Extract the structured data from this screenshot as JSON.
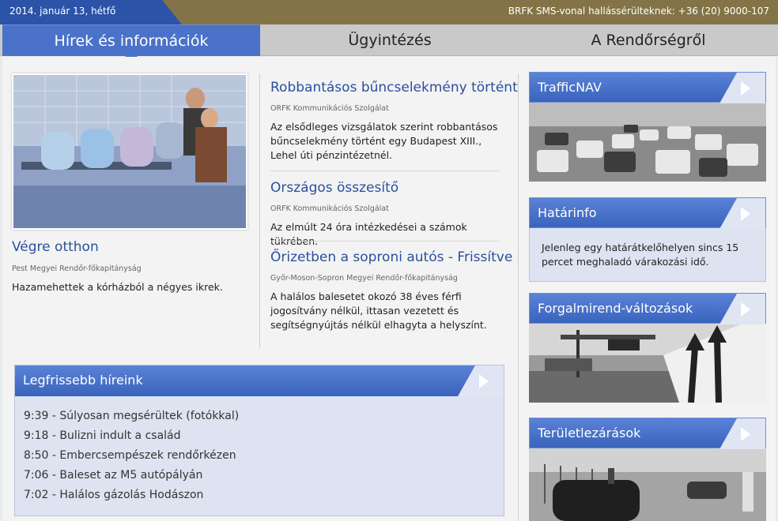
{
  "topbar": {
    "date": "2014. január 13, hétfő",
    "sms_notice": "BRFK SMS-vonal hallássérülteknek: +36 (20) 9000-107"
  },
  "nav": {
    "tabs": [
      {
        "label": "Hírek és információk",
        "active": true
      },
      {
        "label": "Ügyintézés",
        "active": false
      },
      {
        "label": "A Rendőrségről",
        "active": false
      }
    ]
  },
  "lead": {
    "title": "Végre otthon",
    "source": "Pest Megyei Rendőr-főkapitányság",
    "text": "Hazamehettek a kórházból a négyes ikrek."
  },
  "articles": [
    {
      "title": "Robbantásos bűncselekmény történt",
      "source": "ORFK Kommunikációs Szolgálat",
      "text": "Az elsődleges vizsgálatok szerint robbantásos bűncselekmény történt egy Budapest XIII., Lehel úti pénzintézetnél."
    },
    {
      "title": "Országos összesítő",
      "source": "ORFK Kommunikációs Szolgálat",
      "text": "Az elmúlt 24 óra intézkedései a számok tükrében."
    },
    {
      "title": "Őrizetben a soproni autós - Frissítve",
      "source": "Győr-Moson-Sopron Megyei Rendőr-főkapitányság",
      "text": "A halálos balesetet okozó 38 éves férfi jogosítvány nélkül, ittasan vezetett és segítségnyújtás nélkül elhagyta a helyszínt."
    }
  ],
  "latest": {
    "title": "Legfrissebb híreink",
    "items": [
      "9:39 - Súlyosan megsérültek (fotókkal)",
      "9:18 - Bulizni indult a család",
      "8:50 - Embercsempészek rendőrkézen",
      "7:06 - Baleset az M5 autópályán",
      "7:02 - Halálos gázolás Hodászon"
    ]
  },
  "widgets": {
    "trafficnav": {
      "title": "TrafficNAV"
    },
    "hatarinfo": {
      "title": "Határinfo",
      "text": "Jelenleg egy határátkelőhelyen sincs 15 percet meghaladó várakozási idő."
    },
    "forgalmirend": {
      "title": "Forgalmirend-változások"
    },
    "teruletlezarasok": {
      "title": "Területlezárások"
    }
  },
  "colors": {
    "accent_blue": "#4a72c9",
    "link_blue": "#2b4f9e",
    "topbar_gold": "#837448",
    "date_blue": "#2b53a8"
  }
}
